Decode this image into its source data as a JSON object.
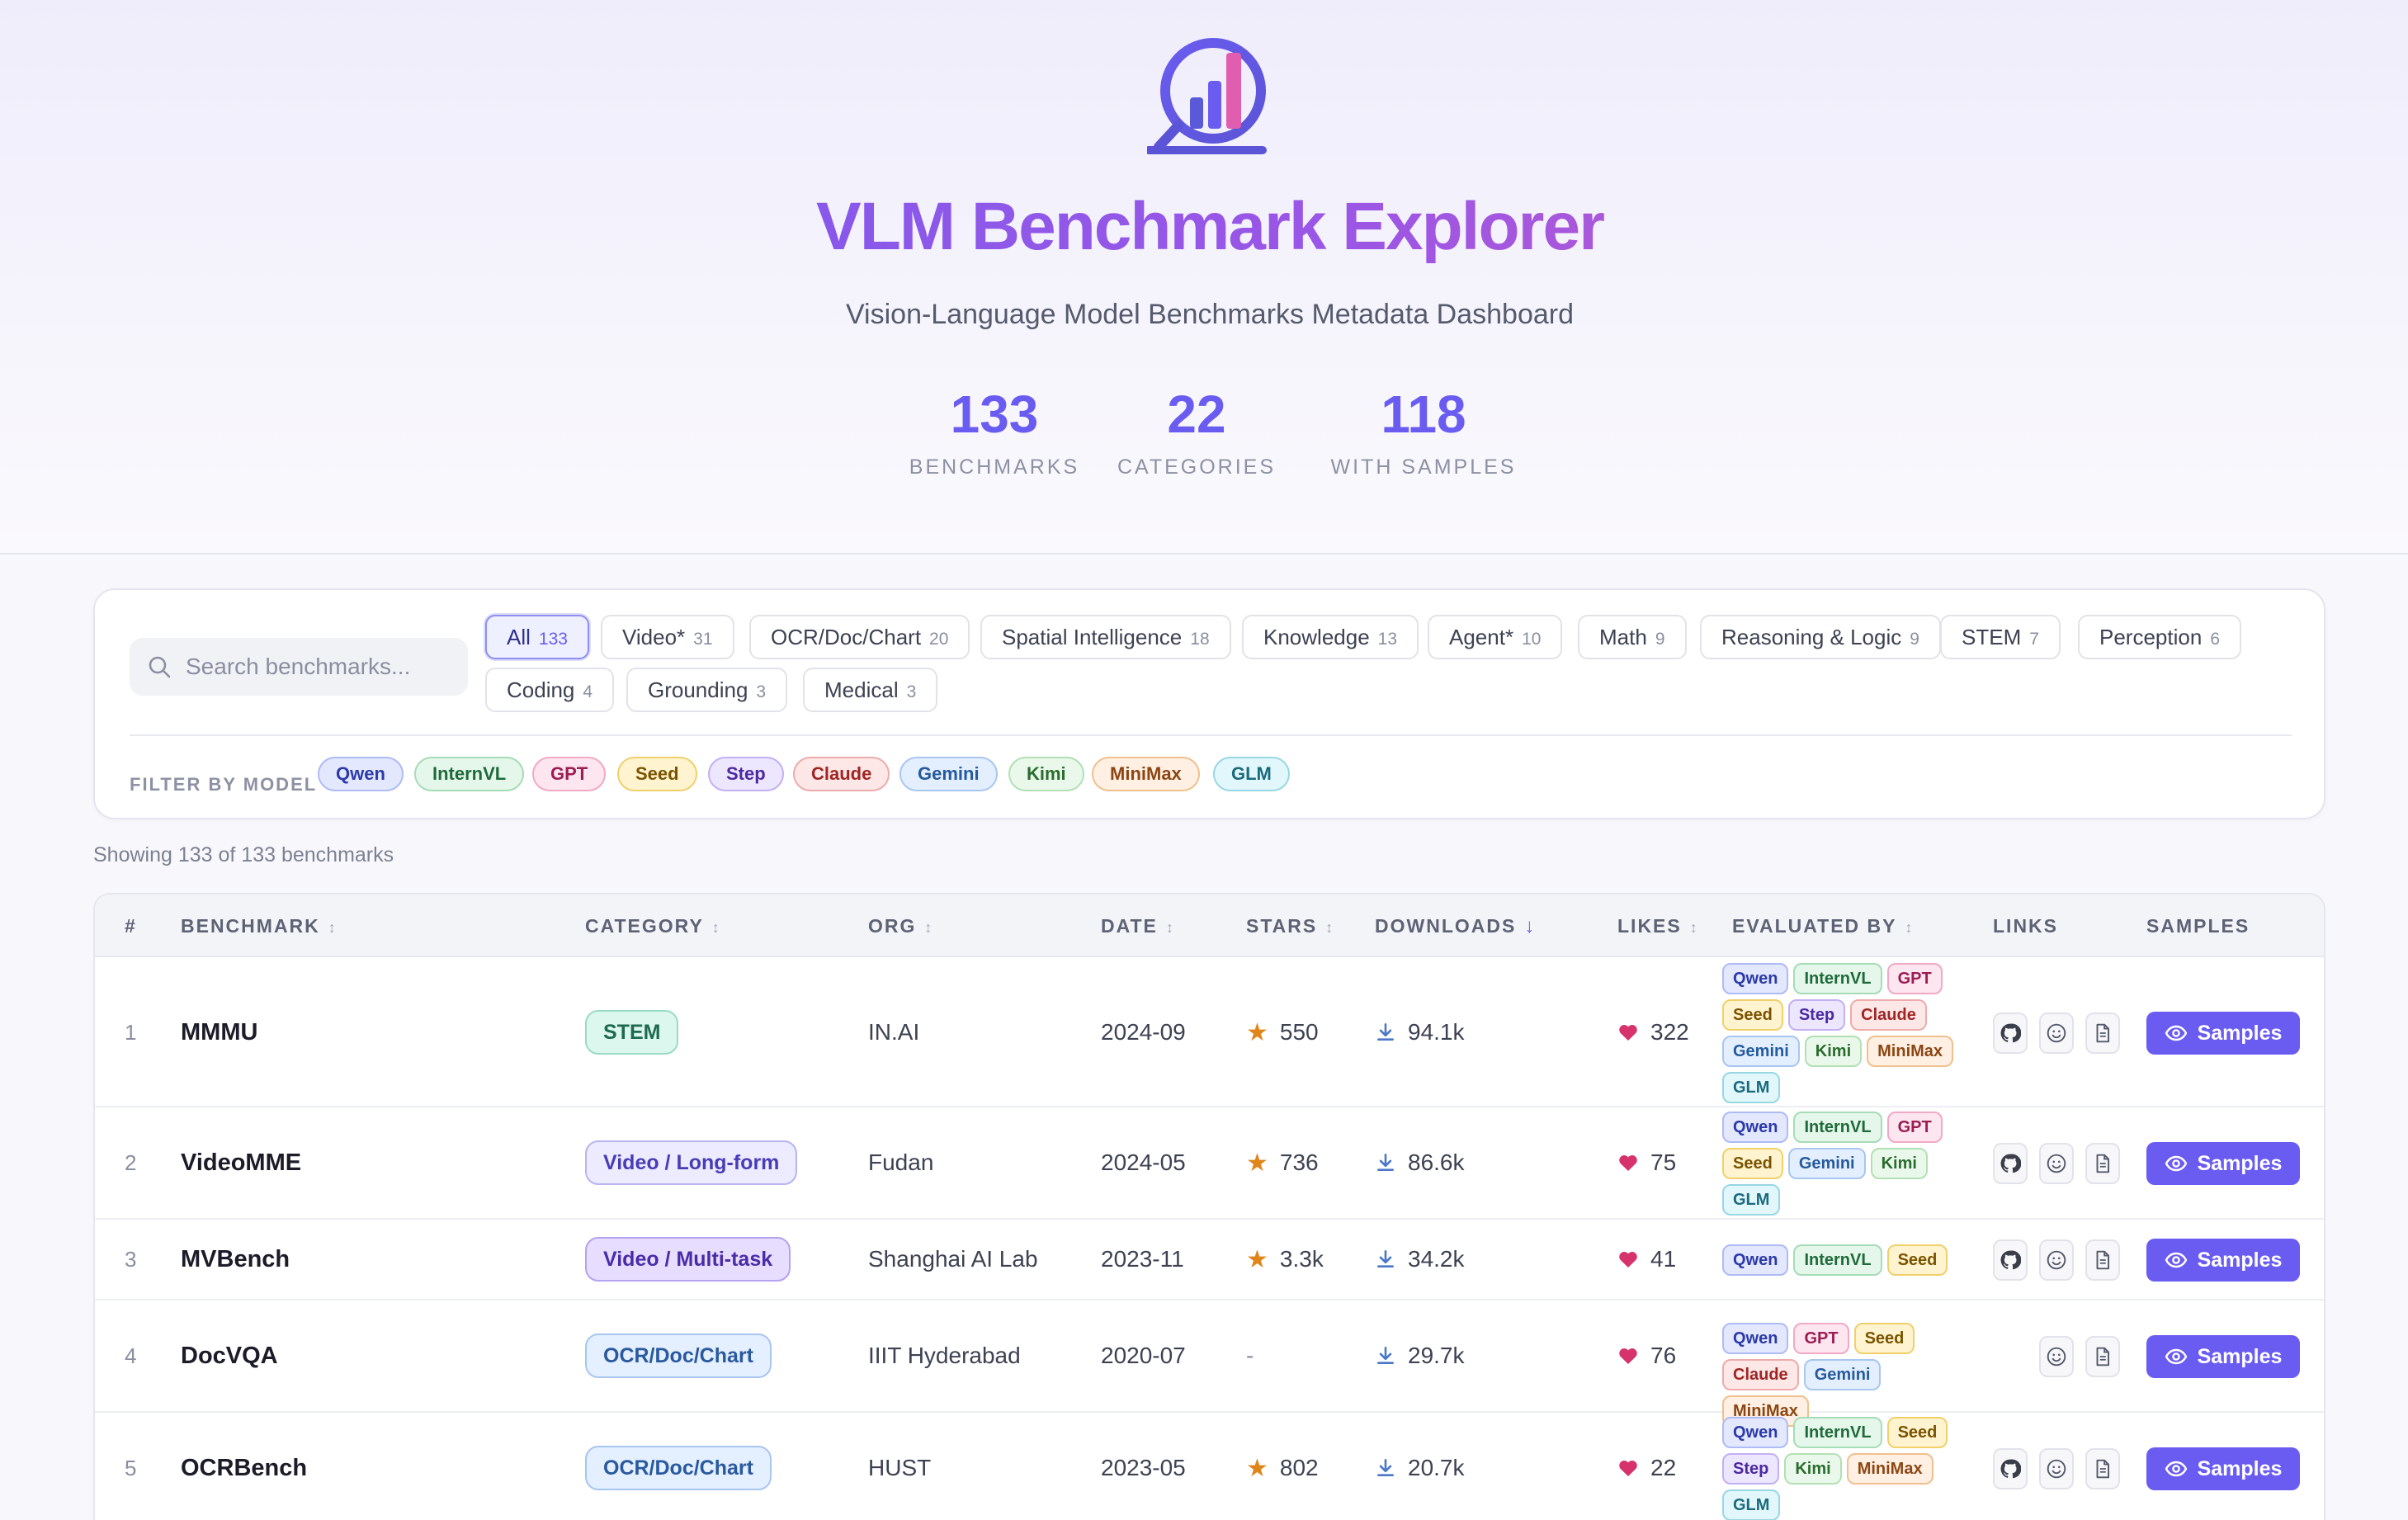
{
  "header": {
    "title": "VLM Benchmark Explorer",
    "subtitle": "Vision-Language Model Benchmarks Metadata Dashboard",
    "logo_icon": "chart-magnifier-logo",
    "stats": [
      {
        "value": "133",
        "label": "BENCHMARKS"
      },
      {
        "value": "22",
        "label": "CATEGORIES"
      },
      {
        "value": "118",
        "label": "WITH SAMPLES"
      }
    ]
  },
  "search": {
    "placeholder": "Search benchmarks...",
    "value": ""
  },
  "categories": [
    {
      "label": "All",
      "count": "133",
      "active": true
    },
    {
      "label": "Video*",
      "count": "31"
    },
    {
      "label": "OCR/Doc/Chart",
      "count": "20"
    },
    {
      "label": "Spatial Intelligence",
      "count": "18"
    },
    {
      "label": "Knowledge",
      "count": "13"
    },
    {
      "label": "Agent*",
      "count": "10"
    },
    {
      "label": "Math",
      "count": "9"
    },
    {
      "label": "Reasoning & Logic",
      "count": "9"
    },
    {
      "label": "STEM",
      "count": "7"
    },
    {
      "label": "Perception",
      "count": "6"
    },
    {
      "label": "Coding",
      "count": "4"
    },
    {
      "label": "Grounding",
      "count": "3"
    },
    {
      "label": "Medical",
      "count": "3"
    }
  ],
  "model_filter": {
    "label": "FILTER BY MODEL",
    "models": [
      "Qwen",
      "InternVL",
      "GPT",
      "Seed",
      "Step",
      "Claude",
      "Gemini",
      "Kimi",
      "MiniMax",
      "GLM"
    ]
  },
  "showing_text": "Showing 133 of 133 benchmarks",
  "table": {
    "columns": [
      "#",
      "BENCHMARK",
      "CATEGORY",
      "ORG",
      "DATE",
      "STARS",
      "DOWNLOADS",
      "LIKES",
      "EVALUATED BY",
      "LINKS",
      "SAMPLES"
    ],
    "sorted_column": "DOWNLOADS",
    "samples_label": "Samples",
    "rows": [
      {
        "rank": "1",
        "name": "MMMU",
        "category": "STEM",
        "org": "IN.AI",
        "date": "2024-09",
        "stars": "550",
        "downloads": "94.1k",
        "likes": "322",
        "evaluated_by": [
          "Qwen",
          "InternVL",
          "GPT",
          "Seed",
          "Step",
          "Claude",
          "Gemini",
          "Kimi",
          "MiniMax",
          "GLM"
        ],
        "links": [
          "github",
          "huggingface",
          "paper"
        ]
      },
      {
        "rank": "2",
        "name": "VideoMME",
        "category": "Video / Long-form",
        "org": "Fudan",
        "date": "2024-05",
        "stars": "736",
        "downloads": "86.6k",
        "likes": "75",
        "evaluated_by": [
          "Qwen",
          "InternVL",
          "GPT",
          "Seed",
          "Gemini",
          "Kimi",
          "GLM"
        ],
        "links": [
          "github",
          "huggingface",
          "paper"
        ]
      },
      {
        "rank": "3",
        "name": "MVBench",
        "category": "Video / Multi-task",
        "org": "Shanghai AI Lab",
        "date": "2023-11",
        "stars": "3.3k",
        "downloads": "34.2k",
        "likes": "41",
        "evaluated_by": [
          "Qwen",
          "InternVL",
          "Seed"
        ],
        "links": [
          "github",
          "huggingface",
          "paper"
        ]
      },
      {
        "rank": "4",
        "name": "DocVQA",
        "category": "OCR/Doc/Chart",
        "org": "IIIT Hyderabad",
        "date": "2020-07",
        "stars": "-",
        "downloads": "29.7k",
        "likes": "76",
        "evaluated_by": [
          "Qwen",
          "GPT",
          "Seed",
          "Claude",
          "Gemini",
          "MiniMax"
        ],
        "links": [
          "huggingface",
          "paper"
        ]
      },
      {
        "rank": "5",
        "name": "OCRBench",
        "category": "OCR/Doc/Chart",
        "org": "HUST",
        "date": "2023-05",
        "stars": "802",
        "downloads": "20.7k",
        "likes": "22",
        "evaluated_by": [
          "Qwen",
          "InternVL",
          "Seed",
          "Step",
          "Kimi",
          "MiniMax",
          "GLM"
        ],
        "links": [
          "github",
          "huggingface",
          "paper"
        ]
      }
    ]
  }
}
